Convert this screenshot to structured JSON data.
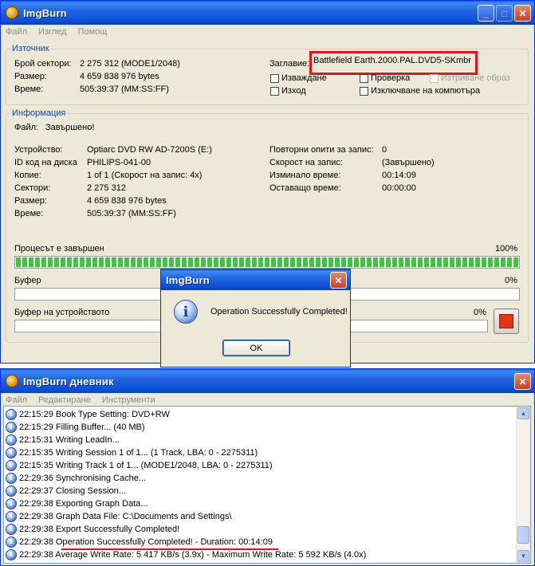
{
  "main": {
    "title": "ImgBurn",
    "menu": [
      "Файл",
      "Изглед",
      "Помощ"
    ],
    "source": {
      "legend": "Източник",
      "rows": [
        {
          "label": "Брой сектори:",
          "value": "2 275 312 (MODE1/2048)"
        },
        {
          "label": "Размер:",
          "value": "4 659 838 976 bytes"
        },
        {
          "label": "Време:",
          "value": "505:39:37 (MM:SS:FF)"
        }
      ],
      "title_label": "Заглавие:",
      "title_value": "Battlefield Earth.2000.PAL.DVD5-SKmbr",
      "checkboxes": {
        "eject": "Изваждане",
        "verify": "Проверка",
        "delete_image": "Изтриване образ",
        "exit": "Изход",
        "shutdown": "Изключване на компютъра"
      }
    },
    "info": {
      "legend": "Информация",
      "file_label": "Файл:",
      "file_value": "Завършено!",
      "left": [
        {
          "label": "Устройство:",
          "value": "Optiarc DVD RW AD-7200S (E:)"
        },
        {
          "label": "ID код на диска",
          "value": "PHILIPS-041-00"
        },
        {
          "label": "Копие:",
          "value": "1 of 1 (Скорост на запис: 4x)"
        },
        {
          "label": "Сектори:",
          "value": "2 275 312"
        },
        {
          "label": "Размер:",
          "value": "4 659 838 976 bytes"
        },
        {
          "label": "Време:",
          "value": "505:39:37 (MM:SS:FF)"
        }
      ],
      "right": [
        {
          "label": "Повторни опити за запис:",
          "value": "0"
        },
        {
          "label": "Скорост на запис:",
          "value": "(Завършено)"
        },
        {
          "label": "Изминало време:",
          "value": "00:14:09"
        },
        {
          "label": "Оставащо време:",
          "value": "00:00:00"
        }
      ]
    },
    "progress": {
      "label": "Процесът е завършен",
      "percent_text": "100%",
      "value": 1.0
    },
    "buffer": {
      "label": "Буфер",
      "percent_text": "0%",
      "value": 0
    },
    "device_buffer": {
      "label": "Буфер на устройството",
      "percent_text": "0%",
      "value": 0
    }
  },
  "dialog": {
    "title": "ImgBurn",
    "message": "Operation Successfully Completed!",
    "ok_label": "OK",
    "info_glyph": "i"
  },
  "log": {
    "title": "ImgBurn дневник",
    "menu": [
      "Файл",
      "Редактиране",
      "Инструменти"
    ],
    "info_glyph": "i",
    "lines": [
      "22:15:29 Book Type Setting: DVD+RW",
      "22:15:29 Filling Buffer... (40 MB)",
      "22:15:31 Writing LeadIn...",
      "22:15:35 Writing Session 1 of 1... (1 Track, LBA: 0 - 2275311)",
      "22:15:35 Writing Track 1 of 1... (MODE1/2048, LBA: 0 - 2275311)",
      "22:29:36 Synchronising Cache...",
      "22:29:37 Closing Session...",
      "22:29:38 Exporting Graph Data...",
      "22:29:38 Graph Data File: C:\\Documents and Settings\\",
      "22:29:38 Export Successfully Completed!",
      "22:29:38 Operation Successfully Completed! - Duration: 00:14:09",
      "22:29:38 Average Write Rate: 5 417 KB/s (3.9x) - Maximum Write Rate: 5 592 KB/s (4.0x)"
    ]
  },
  "window_buttons": {
    "minimize": "_",
    "maximize": "□",
    "close": "✕"
  }
}
